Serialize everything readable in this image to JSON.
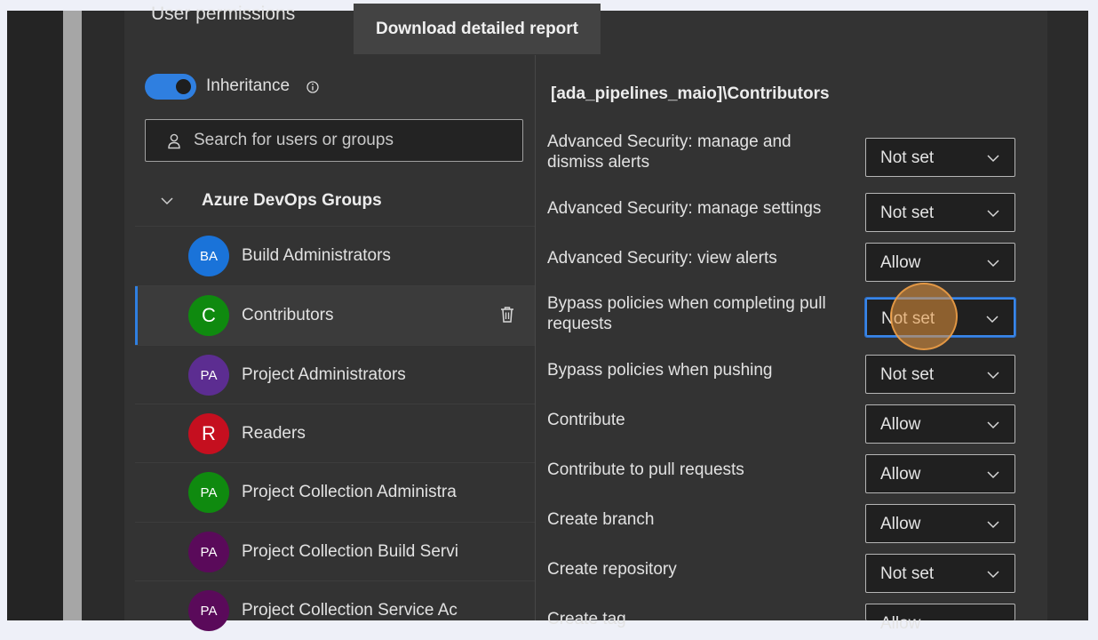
{
  "panel": {
    "title": "User permissions",
    "tooltip": "Download detailed report"
  },
  "inheritance": {
    "label": "Inheritance",
    "enabled": true
  },
  "search": {
    "placeholder": "Search for users or groups",
    "value": ""
  },
  "group": {
    "label": "Azure DevOps Groups",
    "items": [
      {
        "initials": "BA",
        "name": "Build Administrators",
        "color": "#1a73d9"
      },
      {
        "initials": "C",
        "name": "Contributors",
        "color": "#0f8a0f",
        "selected": true
      },
      {
        "initials": "PA",
        "name": "Project Administrators",
        "color": "#5c2d91"
      },
      {
        "initials": "R",
        "name": "Readers",
        "color": "#c50f1f"
      },
      {
        "initials": "PA",
        "name": "Project Collection Administra",
        "color": "#0f8a0f"
      },
      {
        "initials": "PA",
        "name": "Project Collection Build Servi",
        "color": "#5a0a5a"
      },
      {
        "initials": "PA",
        "name": "Project Collection Service Ac",
        "color": "#5a0a5a"
      }
    ]
  },
  "permissions": {
    "title": "[ada_pipelines_maio]\\Contributors",
    "items": [
      {
        "label": "Advanced Security: manage and dismiss alerts",
        "value": "Not set"
      },
      {
        "label": "Advanced Security: manage settings",
        "value": "Not set"
      },
      {
        "label": "Advanced Security: view alerts",
        "value": "Allow"
      },
      {
        "label": "Bypass policies when completing pull requests",
        "value": "Not set",
        "focused": true
      },
      {
        "label": "Bypass policies when pushing",
        "value": "Not set"
      },
      {
        "label": "Contribute",
        "value": "Allow"
      },
      {
        "label": "Contribute to pull requests",
        "value": "Allow"
      },
      {
        "label": "Create branch",
        "value": "Allow"
      },
      {
        "label": "Create repository",
        "value": "Not set"
      },
      {
        "label": "Create tag",
        "value": "Allow"
      }
    ]
  },
  "colors": {
    "accent": "#2f7fe0",
    "cursor": "#e8963c"
  }
}
